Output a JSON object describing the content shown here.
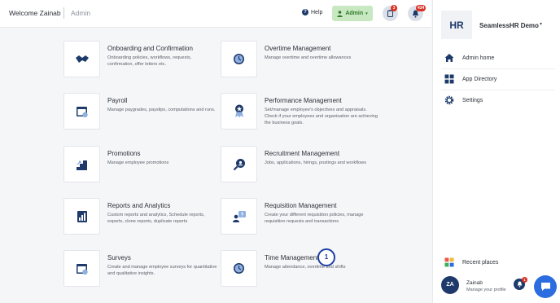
{
  "header": {
    "welcome": "Welcome Zainab",
    "breadcrumb": "Admin",
    "help_label": "Help",
    "admin_label": "Admin",
    "tasks_badge": "3",
    "notifications_badge": "434"
  },
  "cards": [
    {
      "title": "Onboarding and Confirmation",
      "desc": "Onboarding policies, workflows, requests, confirmation, offer letters etc.",
      "icon": "handshake-icon"
    },
    {
      "title": "Overtime Management",
      "desc": "Manage overtime and overtime allowances",
      "icon": "clock-icon"
    },
    {
      "title": "Payroll",
      "desc": "Manage paygrades, payslips, computations and runs.",
      "icon": "calendar-icon"
    },
    {
      "title": "Performance Management",
      "desc": "Set/manage employee's objectives and appraisals. Check if your employees and organisation are achieving the business goals.",
      "icon": "award-icon"
    },
    {
      "title": "Promotions",
      "desc": "Manage employee promotions",
      "icon": "stairs-icon"
    },
    {
      "title": "Recruitment Management",
      "desc": "Jobs, applications, hirings, postings and workflows",
      "icon": "magnifier-user-icon"
    },
    {
      "title": "Reports and Analytics",
      "desc": "Custom reports and analytics, Schedule reports, exports, clone reports, duplicate reports",
      "icon": "bar-chart-icon"
    },
    {
      "title": "Requisition Management",
      "desc": "Create your different requisition policies, manage requisition requests and transactions",
      "icon": "user-question-icon"
    },
    {
      "title": "Surveys",
      "desc": "Create and manage employee surveys for quantitative and qualitative insights.",
      "icon": "calendar-icon"
    },
    {
      "title": "Time Management",
      "desc": "Manage attendance, overtime and shifts",
      "icon": "clock-icon"
    }
  ],
  "step_marker": "1",
  "sidebar": {
    "logo_text": "HR",
    "company": "SeamlessHR Demo",
    "items": [
      {
        "label": "Admin home",
        "icon": "home-icon"
      },
      {
        "label": "App Directory",
        "icon": "grid-icon"
      },
      {
        "label": "Settings",
        "icon": "gear-icon"
      }
    ],
    "recent_places": "Recent places",
    "profile": {
      "initials": "ZA",
      "name": "Zainab",
      "sub": "Manage your profile"
    },
    "profile_badge": "1"
  },
  "colors": {
    "navy": "#1d3a6b",
    "admin_green": "#c8e8c2",
    "badge_red": "#d93025",
    "chat_blue": "#2b6de0"
  }
}
